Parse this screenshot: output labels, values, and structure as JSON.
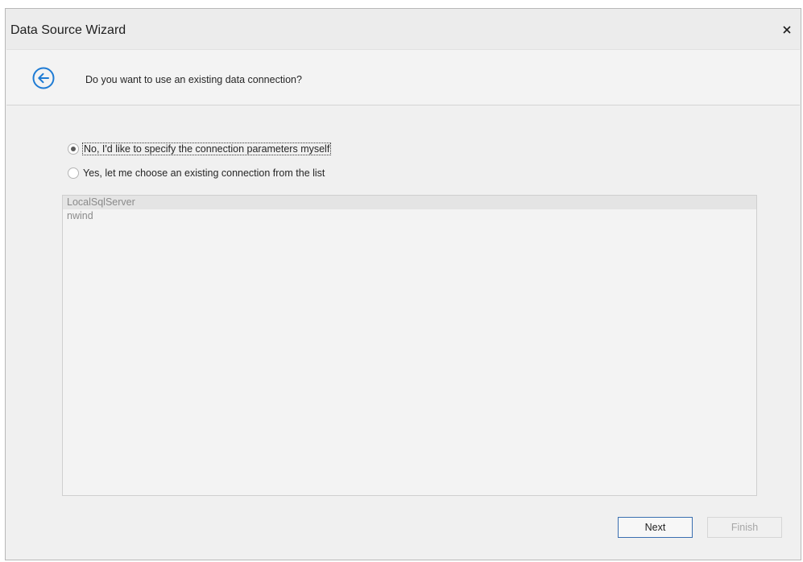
{
  "window": {
    "title": "Data Source Wizard",
    "close_icon": "close-icon"
  },
  "header": {
    "back_icon": "back-arrow-icon",
    "question": "Do you want to use an existing data connection?"
  },
  "options": [
    {
      "label": "No, I'd like to specify the connection parameters myself",
      "selected": true
    },
    {
      "label": "Yes, let me choose an existing connection from the list",
      "selected": false
    }
  ],
  "connections": {
    "items": [
      "LocalSqlServer",
      "nwind"
    ],
    "selected_index": 0
  },
  "footer": {
    "next_label": "Next",
    "finish_label": "Finish"
  },
  "colors": {
    "accent": "#1e7bd4",
    "next_border": "#3a6fb0"
  }
}
